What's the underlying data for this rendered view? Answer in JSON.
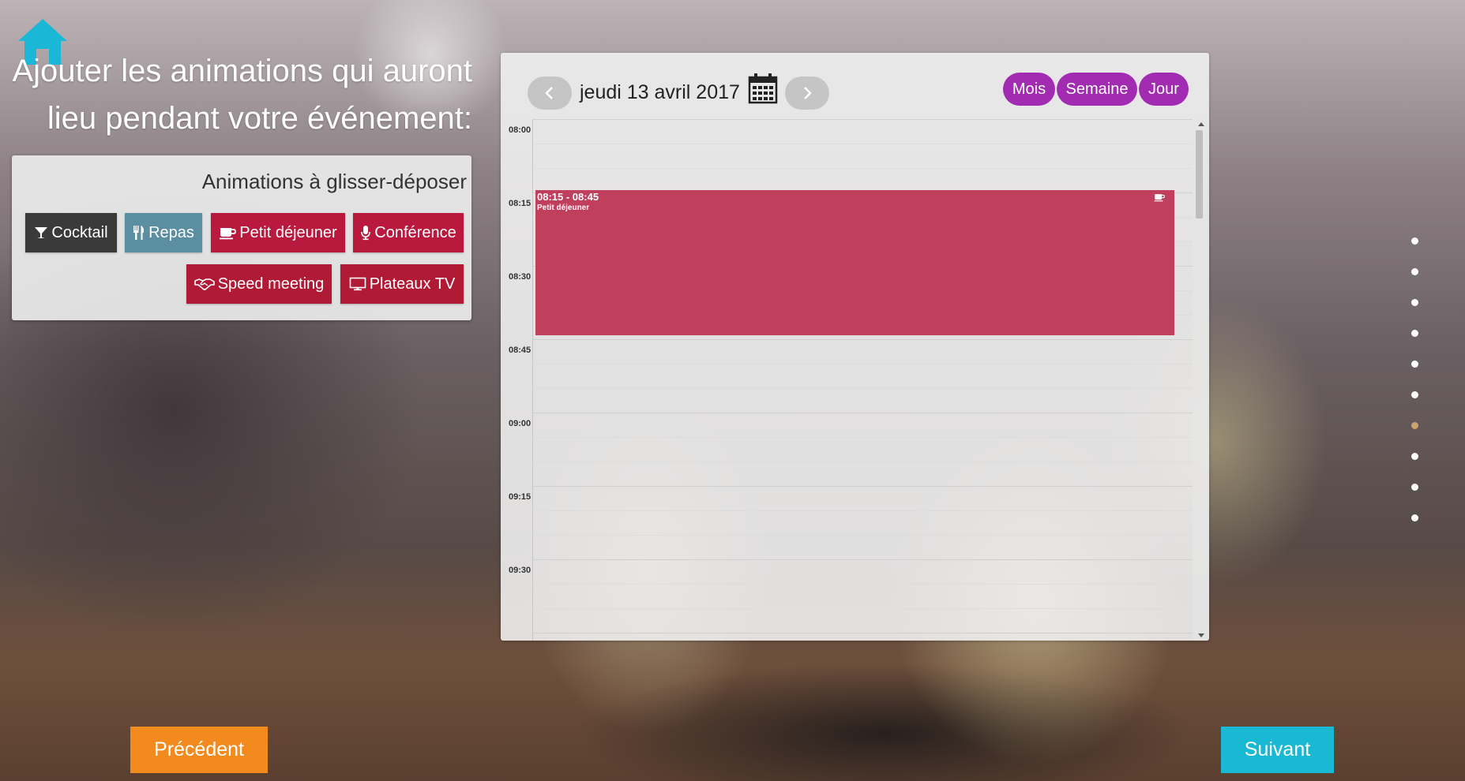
{
  "home": {
    "icon": "home-icon",
    "color": "#1ab8d6"
  },
  "heading": {
    "line1": "Ajouter les animations qui auront",
    "line2": "lieu pendant votre événement:"
  },
  "animations_panel": {
    "title": "Animations à glisser-déposer",
    "items": [
      {
        "label": "Cocktail",
        "icon": "cocktail-icon",
        "color": "#3a3a3a"
      },
      {
        "label": "Repas",
        "icon": "utensils-icon",
        "color": "#5b8ea1"
      },
      {
        "label": "Petit déjeuner",
        "icon": "coffee-icon",
        "color": "#b8193c"
      },
      {
        "label": "Conférence",
        "icon": "microphone-icon",
        "color": "#b8193c"
      },
      {
        "label": "Speed meeting",
        "icon": "handshake-icon",
        "color": "#b01a35"
      },
      {
        "label": "Plateaux TV",
        "icon": "tv-icon",
        "color": "#b01a35"
      }
    ]
  },
  "calendar": {
    "date": "jeudi 13 avril 2017",
    "views": [
      "Mois",
      "Semaine",
      "Jour"
    ],
    "view_color": "#a12bb1",
    "times": [
      "08:00",
      "08:15",
      "08:30",
      "08:45",
      "09:00",
      "09:15",
      "09:30"
    ],
    "event": {
      "time": "08:15 - 08:45",
      "title": "Petit déjeuner",
      "icon": "coffee-icon",
      "color": "#bf3f5c"
    }
  },
  "side_nav": {
    "count": 10,
    "active_index": 6,
    "active_color": "#c9a56d"
  },
  "footer": {
    "prev_label": "Précédent",
    "prev_color": "#f28a1e",
    "next_label": "Suivant",
    "next_color": "#19b9d4"
  }
}
